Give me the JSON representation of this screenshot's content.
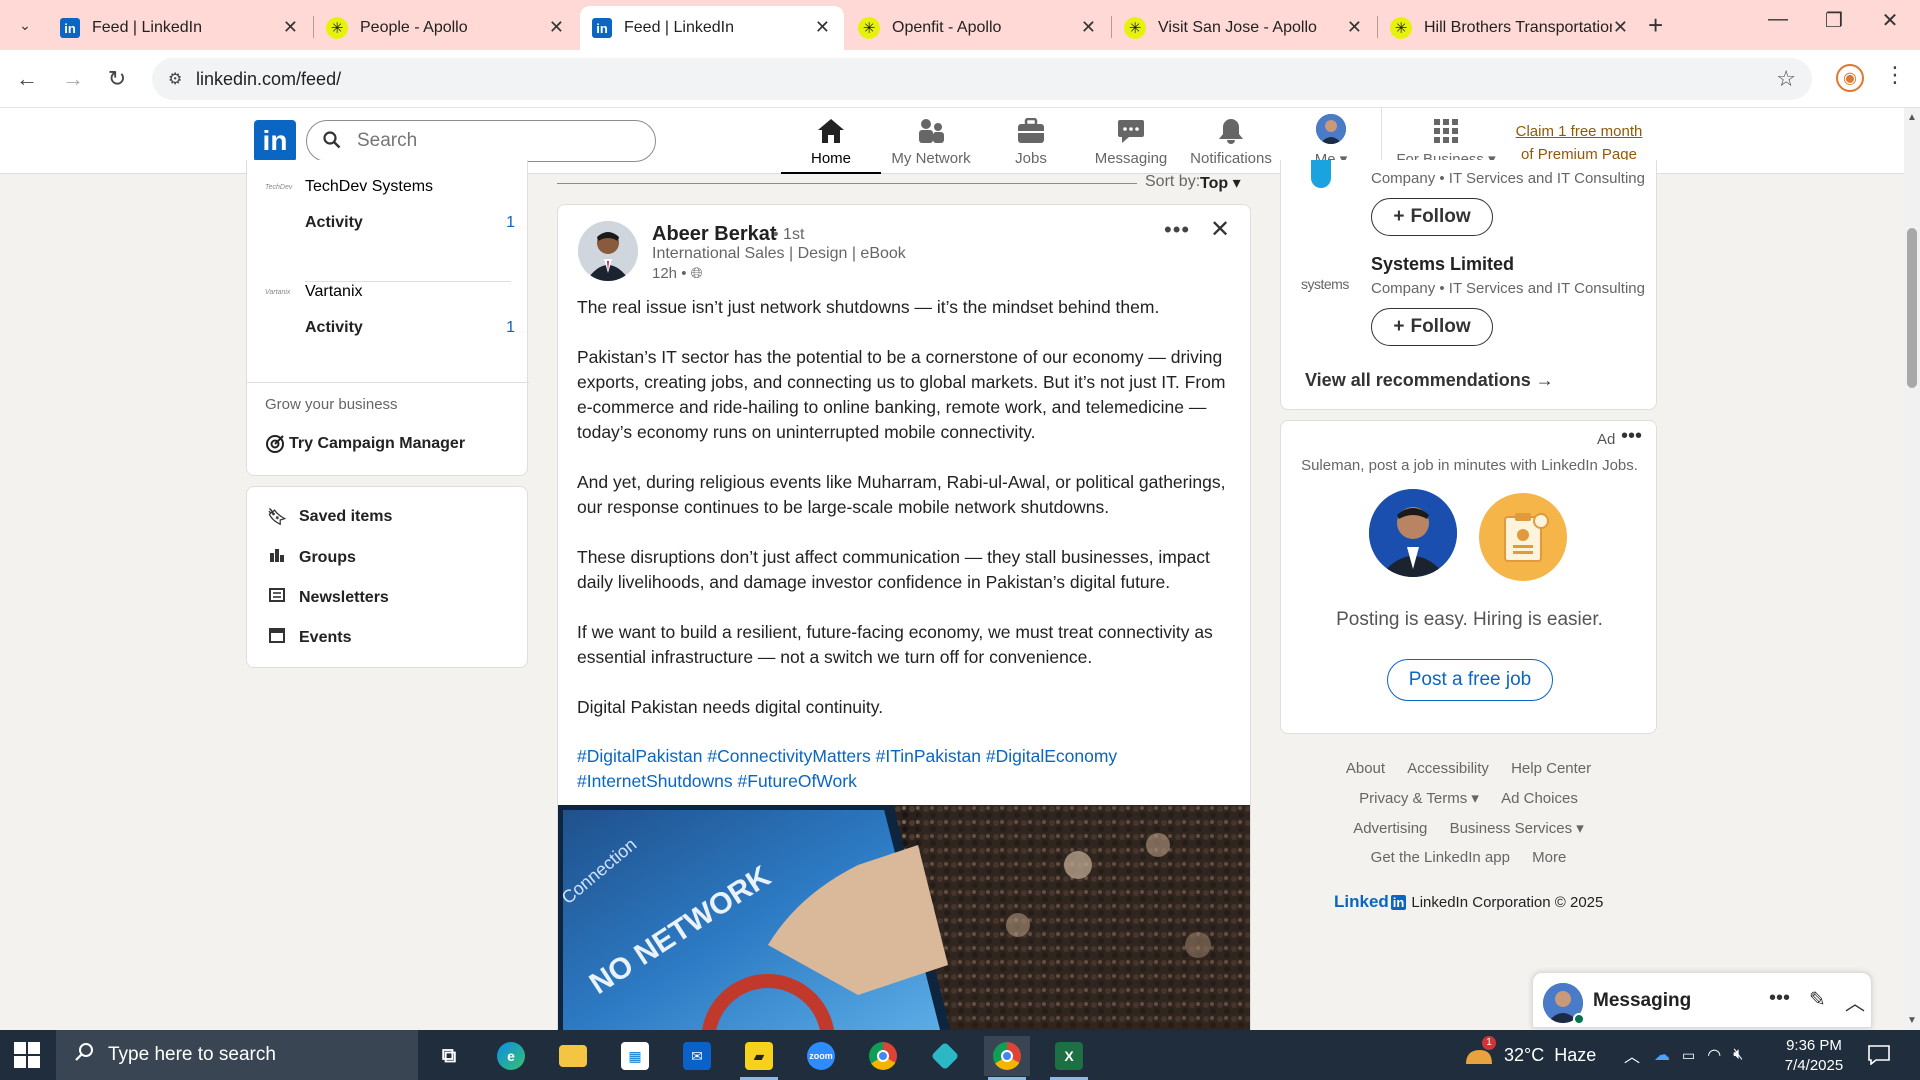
{
  "browser": {
    "tabs": [
      {
        "title": "Feed | LinkedIn",
        "favicon": "linkedin-icon",
        "active": false
      },
      {
        "title": "People - Apollo",
        "favicon": "apollo-icon",
        "active": false
      },
      {
        "title": "Feed | LinkedIn",
        "favicon": "linkedin-icon",
        "active": true
      },
      {
        "title": "Openfit - Apollo",
        "favicon": "apollo-icon",
        "active": false
      },
      {
        "title": "Visit San Jose - Apollo",
        "favicon": "apollo-icon",
        "active": false
      },
      {
        "title": "Hill Brothers Transportation",
        "favicon": "apollo-icon",
        "active": false
      }
    ],
    "url": "linkedin.com/feed/"
  },
  "header": {
    "search_placeholder": "Search",
    "nav": [
      {
        "label": "Home",
        "icon": "home-icon",
        "active": true
      },
      {
        "label": "My Network",
        "icon": "network-icon",
        "active": false
      },
      {
        "label": "Jobs",
        "icon": "briefcase-icon",
        "active": false
      },
      {
        "label": "Messaging",
        "icon": "messaging-icon",
        "active": false
      },
      {
        "label": "Notifications",
        "icon": "bell-icon",
        "active": false
      },
      {
        "label": "Me",
        "icon": "avatar",
        "active": false
      },
      {
        "label": "For Business",
        "icon": "grid-icon",
        "active": false
      }
    ],
    "premium_line1": "Claim 1 free month",
    "premium_line2": "of Premium Page"
  },
  "left": {
    "pages": [
      {
        "name": "TechDev Systems",
        "activity_label": "Activity",
        "activity_count": "1"
      },
      {
        "name": "Vartanix",
        "activity_label": "Activity",
        "activity_count": "1"
      }
    ],
    "grow_label": "Grow your business",
    "campaign_label": "Try Campaign Manager",
    "links": [
      "Saved items",
      "Groups",
      "Newsletters",
      "Events"
    ]
  },
  "feed": {
    "sort_label": "Sort by:",
    "sort_value": "Top",
    "post": {
      "author": "Abeer Berkat",
      "degree": "• 1st",
      "headline": "International Sales | Design | eBook",
      "time": "12h •",
      "paragraphs": [
        "The real issue isn’t just network shutdowns — it’s the mindset behind them.",
        "Pakistan’s IT sector has the potential to be a cornerstone of our economy — driving exports, creating jobs, and connecting us to global markets. But it’s not just IT. From e-commerce and ride-hailing to online banking, remote work, and telemedicine — today’s economy runs on uninterrupted mobile connectivity.",
        "And yet, during religious events like Muharram, Rabi-ul-Awal, or political gatherings, our response continues to be large-scale mobile network shutdowns.",
        "These disruptions don’t just affect communication — they stall businesses, impact daily livelihoods, and damage investor confidence in Pakistan’s digital future.",
        "If we want to build a resilient, future-facing economy, we must treat connectivity as essential infrastructure — not a switch we turn off for convenience.",
        "Digital Pakistan needs digital continuity."
      ],
      "hashtags": "#DigitalPakistan #ConnectivityMatters #ITinPakistan #DigitalEconomy #InternetShutdowns #FutureOfWork",
      "image_text_1": "NO NETWORK",
      "image_text_2": "Connection"
    }
  },
  "right": {
    "rec_top_sub": "Company • IT Services and IT Consulting",
    "follow_label": "Follow",
    "rec2_logo": "systems",
    "rec2_name": "Systems Limited",
    "rec2_sub": "Company • IT Services and IT Consulting",
    "view_all": "View all recommendations →",
    "ad_label": "Ad",
    "ad_text": "Suleman, post a job in minutes with LinkedIn Jobs.",
    "ad_tagline": "Posting is easy. Hiring is easier.",
    "ad_cta": "Post a free job",
    "footer_row1": [
      "About",
      "Accessibility",
      "Help Center"
    ],
    "footer_row2": [
      "Privacy & Terms ▾",
      "Ad Choices"
    ],
    "footer_row3": [
      "Advertising",
      "Business Services ▾"
    ],
    "footer_row4": [
      "Get the LinkedIn app",
      "More"
    ],
    "footer_brand_a": "Linked",
    "footer_brand_b": "in",
    "footer_copy": "LinkedIn Corporation © 2025"
  },
  "messaging": {
    "title": "Messaging"
  },
  "taskbar": {
    "search_text": "Type here to search",
    "weather": "32°C  Haze",
    "weather_badge": "1",
    "time": "9:36 PM",
    "date": "7/4/2025"
  },
  "colors": {
    "linkedin_blue": "#0a66c2",
    "premium_gold": "#915907",
    "tab_bar": "#ffd9d6",
    "taskbar": "#1f2d3d"
  }
}
